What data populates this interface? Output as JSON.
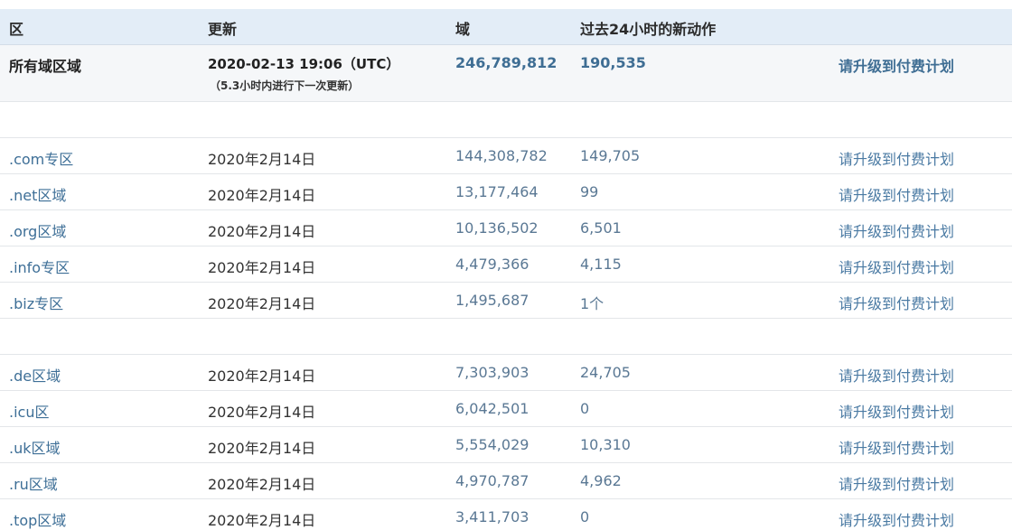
{
  "header": {
    "zone": "区",
    "updated": "更新",
    "domains": "域",
    "new_24h": "过去24小时的新动作"
  },
  "summary": {
    "zone": "所有域区域",
    "updated": "2020-02-13 19:06（UTC）",
    "next_update": "（5.3小时内进行下一次更新）",
    "domains": "246,789,812",
    "new_24h": "190,535",
    "action": "请升级到付费计划"
  },
  "group1": [
    {
      "zone": ".com专区",
      "updated": "2020年2月14日",
      "domains": "144,308,782",
      "new_24h": "149,705",
      "action": "请升级到付费计划"
    },
    {
      "zone": ".net区域",
      "updated": "2020年2月14日",
      "domains": "13,177,464",
      "new_24h": "99",
      "action": "请升级到付费计划"
    },
    {
      "zone": ".org区域",
      "updated": "2020年2月14日",
      "domains": "10,136,502",
      "new_24h": "6,501",
      "action": "请升级到付费计划"
    },
    {
      "zone": ".info专区",
      "updated": "2020年2月14日",
      "domains": "4,479,366",
      "new_24h": "4,115",
      "action": "请升级到付费计划"
    },
    {
      "zone": ".biz专区",
      "updated": "2020年2月14日",
      "domains": "1,495,687",
      "new_24h": "1个",
      "action": "请升级到付费计划"
    }
  ],
  "group2": [
    {
      "zone": ".de区域",
      "updated": "2020年2月14日",
      "domains": "7,303,903",
      "new_24h": "24,705",
      "action": "请升级到付费计划"
    },
    {
      "zone": ".icu区",
      "updated": "2020年2月14日",
      "domains": "6,042,501",
      "new_24h": "0",
      "action": "请升级到付费计划"
    },
    {
      "zone": ".uk区域",
      "updated": "2020年2月14日",
      "domains": "5,554,029",
      "new_24h": "10,310",
      "action": "请升级到付费计划"
    },
    {
      "zone": ".ru区域",
      "updated": "2020年2月14日",
      "domains": "4,970,787",
      "new_24h": "4,962",
      "action": "请升级到付费计划"
    },
    {
      "zone": ".top区域",
      "updated": "2020年2月14日",
      "domains": "3,411,703",
      "new_24h": "0",
      "action": "请升级到付费计划"
    }
  ]
}
